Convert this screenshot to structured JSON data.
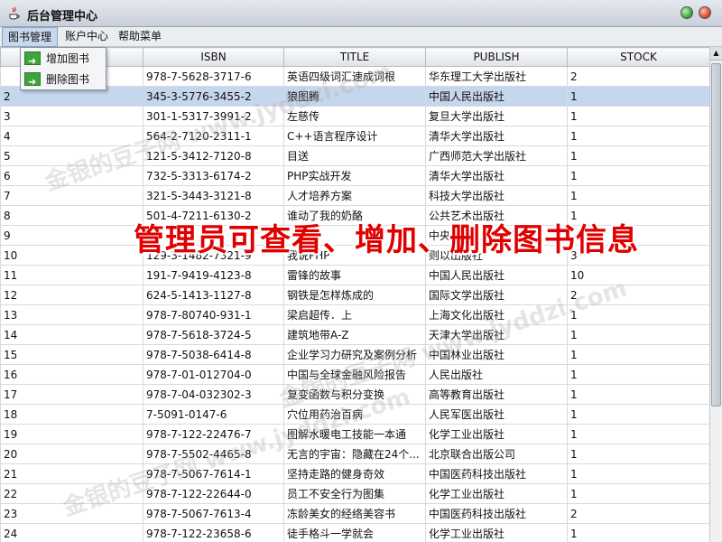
{
  "window": {
    "title": "后台管理中心"
  },
  "menu": [
    "图书管理",
    "账户中心",
    "帮助菜单"
  ],
  "dropdown": [
    "增加图书",
    "删除图书"
  ],
  "table": {
    "headers": [
      "",
      "ISBN",
      "TITLE",
      "PUBLISH",
      "STOCK"
    ],
    "selected_row": 2,
    "rows": [
      [
        "",
        "978-7-5628-3717-6",
        "英语四级词汇速成词根",
        "华东理工大学出版社",
        "2"
      ],
      [
        "2",
        "345-3-5776-3455-2",
        "狼图腾",
        "中国人民出版社",
        "1"
      ],
      [
        "3",
        "301-1-5317-3991-2",
        "左慈传",
        "复旦大学出版社",
        "1"
      ],
      [
        "4",
        "564-2-7120-2311-1",
        "C++语言程序设计",
        "清华大学出版社",
        "1"
      ],
      [
        "5",
        "121-5-3412-7120-8",
        "目送",
        "广西师范大学出版社",
        "1"
      ],
      [
        "6",
        "732-5-3313-6174-2",
        "PHP实战开发",
        "清华大学出版社",
        "1"
      ],
      [
        "7",
        "321-5-3443-3121-8",
        "人才培养方案",
        "科技大学出版社",
        "1"
      ],
      [
        "8",
        "501-4-7211-6130-2",
        "谁动了我的奶酪",
        "公共艺术出版社",
        "1"
      ],
      [
        "9",
        "",
        "",
        "中央人",
        ""
      ],
      [
        "10",
        "129-3-1482-7321-9",
        "我说PHP",
        "则以出版社",
        "3"
      ],
      [
        "11",
        "191-7-9419-4123-8",
        "雷锋的故事",
        "中国人民出版社",
        "10"
      ],
      [
        "12",
        "624-5-1413-1127-8",
        "钢铁是怎样炼成的",
        "国际文学出版社",
        "2"
      ],
      [
        "13",
        "978-7-80740-931-1",
        "梁启超传．上",
        "上海文化出版社",
        "1"
      ],
      [
        "14",
        "978-7-5618-3724-5",
        "建筑地带A-Z",
        "天津大学出版社",
        "1"
      ],
      [
        "15",
        "978-7-5038-6414-8",
        "企业学习力研究及案例分析",
        "中国林业出版社",
        "1"
      ],
      [
        "16",
        "978-7-01-012704-0",
        "中国与全球金融风险报告",
        "人民出版社",
        "1"
      ],
      [
        "17",
        "978-7-04-032302-3",
        "复变函数与积分变换",
        "高等教育出版社",
        "1"
      ],
      [
        "18",
        "7-5091-0147-6",
        "穴位用药治百病",
        "人民军医出版社",
        "1"
      ],
      [
        "19",
        "978-7-122-22476-7",
        "图解水暖电工技能一本通",
        "化学工业出版社",
        "1"
      ],
      [
        "20",
        "978-7-5502-4465-8",
        "无言的宇宙：隐藏在24个...",
        "北京联合出版公司",
        "1"
      ],
      [
        "21",
        "978-7-5067-7614-1",
        "坚持走路的健身奇效",
        "中国医药科技出版社",
        "1"
      ],
      [
        "22",
        "978-7-122-22644-0",
        "员工不安全行为图集",
        "化学工业出版社",
        "1"
      ],
      [
        "23",
        "978-7-5067-7613-4",
        "冻龄美女的经络美容书",
        "中国医药科技出版社",
        "2"
      ],
      [
        "24",
        "978-7-122-23658-6",
        "徒手格斗一学就会",
        "化学工业出版社",
        "1"
      ]
    ]
  },
  "overlay": "管理员可查看、增加、删除图书信息",
  "watermark": "金银的豆子网 www.jyddzi.com"
}
